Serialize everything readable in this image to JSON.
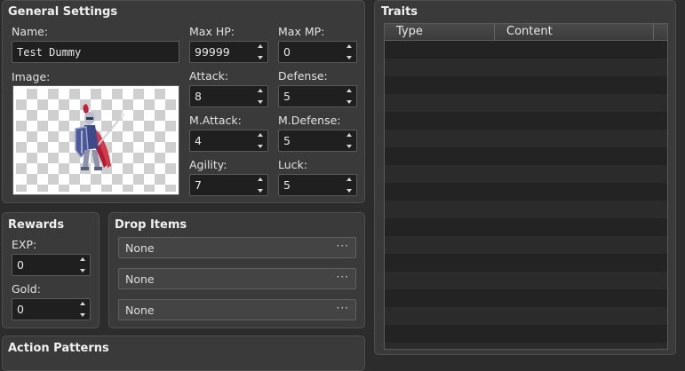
{
  "general": {
    "title": "General Settings",
    "name_label": "Name:",
    "name_value": "Test Dummy",
    "image_label": "Image:",
    "stats": [
      {
        "label": "Max HP:",
        "value": "99999"
      },
      {
        "label": "Max MP:",
        "value": "0"
      },
      {
        "label": "Attack:",
        "value": "8"
      },
      {
        "label": "Defense:",
        "value": "5"
      },
      {
        "label": "M.Attack:",
        "value": "4"
      },
      {
        "label": "M.Defense:",
        "value": "5"
      },
      {
        "label": "Agility:",
        "value": "7"
      },
      {
        "label": "Luck:",
        "value": "5"
      }
    ]
  },
  "rewards": {
    "title": "Rewards",
    "exp_label": "EXP:",
    "exp_value": "0",
    "gold_label": "Gold:",
    "gold_value": "0"
  },
  "drop_items": {
    "title": "Drop Items",
    "items": [
      {
        "value": "None",
        "button": "···"
      },
      {
        "value": "None",
        "button": "···"
      },
      {
        "value": "None",
        "button": "···"
      }
    ]
  },
  "action_patterns": {
    "title": "Action Patterns"
  },
  "traits": {
    "title": "Traits",
    "columns": [
      "Type",
      "Content"
    ]
  },
  "colors": {
    "background": "#2c2c2c",
    "panel": "#3a3a3a",
    "field": "#1f1f1f",
    "sprite_armor": "#3c4a8a",
    "sprite_cape": "#b01e34"
  },
  "icons": {
    "spin_up": "triangle-up",
    "spin_down": "triangle-down",
    "browse": "ellipsis"
  }
}
